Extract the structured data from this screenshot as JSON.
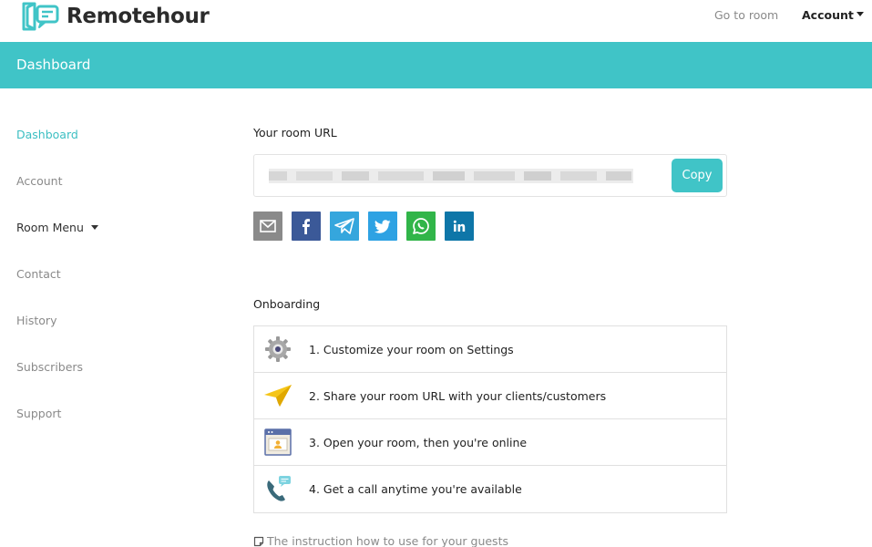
{
  "brand": {
    "name": "Remotehour",
    "accent": "#40c4c7"
  },
  "topnav": {
    "goto_room": "Go to room",
    "account": "Account"
  },
  "header": {
    "title": "Dashboard"
  },
  "sidebar": {
    "items": [
      {
        "label": "Dashboard",
        "active": true
      },
      {
        "label": "Account"
      },
      {
        "label": "Room Menu",
        "has_dropdown": true
      },
      {
        "label": "Contact"
      },
      {
        "label": "History"
      },
      {
        "label": "Subscribers"
      },
      {
        "label": "Support"
      }
    ]
  },
  "room_url": {
    "label": "Your room URL",
    "value_blurred": true,
    "copy_label": "Copy"
  },
  "share": [
    {
      "icon": "email-icon",
      "color": "#8a8a8a"
    },
    {
      "icon": "facebook-icon",
      "color": "#3b5998"
    },
    {
      "icon": "telegram-icon",
      "color": "#35a6dd"
    },
    {
      "icon": "twitter-icon",
      "color": "#2ea2e3"
    },
    {
      "icon": "whatsapp-icon",
      "color": "#31b549"
    },
    {
      "icon": "linkedin-icon",
      "color": "#0e76a8"
    }
  ],
  "onboarding": {
    "label": "Onboarding",
    "steps": [
      {
        "icon": "gear-icon",
        "text": "1. Customize your room on Settings"
      },
      {
        "icon": "paper-plane-icon",
        "text": "2. Share your room URL with your clients/customers"
      },
      {
        "icon": "browser-window-icon",
        "text": "3. Open your room, then you're online"
      },
      {
        "icon": "phone-call-icon",
        "text": "4. Get a call anytime you're available"
      }
    ]
  },
  "guest_instruction": "The instruction how to use for your guests"
}
